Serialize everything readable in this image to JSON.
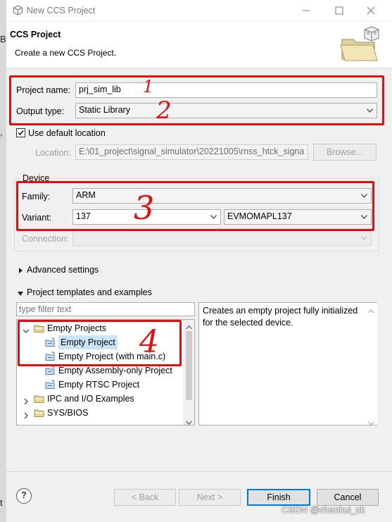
{
  "window": {
    "title": "New CCS Project"
  },
  "banner": {
    "title": "CCS Project",
    "description": "Create a new CCS Project."
  },
  "project": {
    "name_label": "Project name:",
    "name_value": "prj_sim_lib",
    "output_label": "Output type:",
    "output_value": "Static Library"
  },
  "location": {
    "use_default_label": "Use default location",
    "use_default_checked": true,
    "label": "Location:",
    "value": "E:\\01_project\\signal_simulator\\20221005\\rnss_htck_signa",
    "browse_label": "Browse..."
  },
  "device": {
    "group_label": "Device",
    "family_label": "Family:",
    "family_value": "ARM",
    "variant_label": "Variant:",
    "variant_filter": "137",
    "variant_value": "EVMOMAPL137",
    "connection_label": "Connection:",
    "connection_value": ""
  },
  "advanced": {
    "label": "Advanced settings"
  },
  "templates": {
    "label": "Project templates and examples",
    "filter_placeholder": "type filter text",
    "tree": [
      {
        "label": "Empty Projects",
        "level": 0,
        "expanded": true,
        "kind": "folder"
      },
      {
        "label": "Empty Project",
        "level": 1,
        "kind": "item",
        "selected": true
      },
      {
        "label": "Empty Project (with main.c)",
        "level": 1,
        "kind": "item"
      },
      {
        "label": "Empty Assembly-only Project",
        "level": 1,
        "kind": "item"
      },
      {
        "label": "Empty RTSC Project",
        "level": 1,
        "kind": "item"
      },
      {
        "label": "IPC and I/O Examples",
        "level": 0,
        "expanded": false,
        "kind": "folder"
      },
      {
        "label": "SYS/BIOS",
        "level": 0,
        "expanded": false,
        "kind": "folder"
      }
    ],
    "description": "Creates an empty project fully initialized for the selected device."
  },
  "annotations": [
    "1",
    "2",
    "3",
    "4"
  ],
  "footer": {
    "help_label": "?",
    "back_label": "< Back",
    "next_label": "Next >",
    "finish_label": "Finish",
    "cancel_label": "Cancel"
  },
  "watermark": "CSDN @chenkui_ck",
  "colors": {
    "annotation_red": "#e01010",
    "selection_blue": "#cce4f7",
    "dialog_bg": "#f0f0f0",
    "primary_border": "#0078d7"
  }
}
